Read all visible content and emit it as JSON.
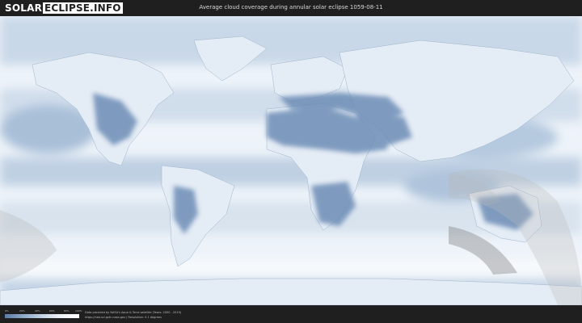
{
  "header": {
    "logo_left": "SOLAR",
    "logo_right": "ECLIPSE.INFO",
    "title": "Average cloud coverage during annular solar eclipse 1059-08-11"
  },
  "legend": {
    "ticks": [
      "0%",
      "20%",
      "40%",
      "60%",
      "80%",
      "100%"
    ]
  },
  "footer": {
    "credit_line1": "Data provided by NASA's Aqua & Terra satellite (Years: 2000 - 2019)",
    "credit_line2": "https://neo.sci.gsfc.nasa.gov | Resolution: 0.1 degrees"
  },
  "colors": {
    "clear_sky": "#5b7eab",
    "overcast": "#ffffff",
    "eclipse_path": "#b9b9b9"
  }
}
